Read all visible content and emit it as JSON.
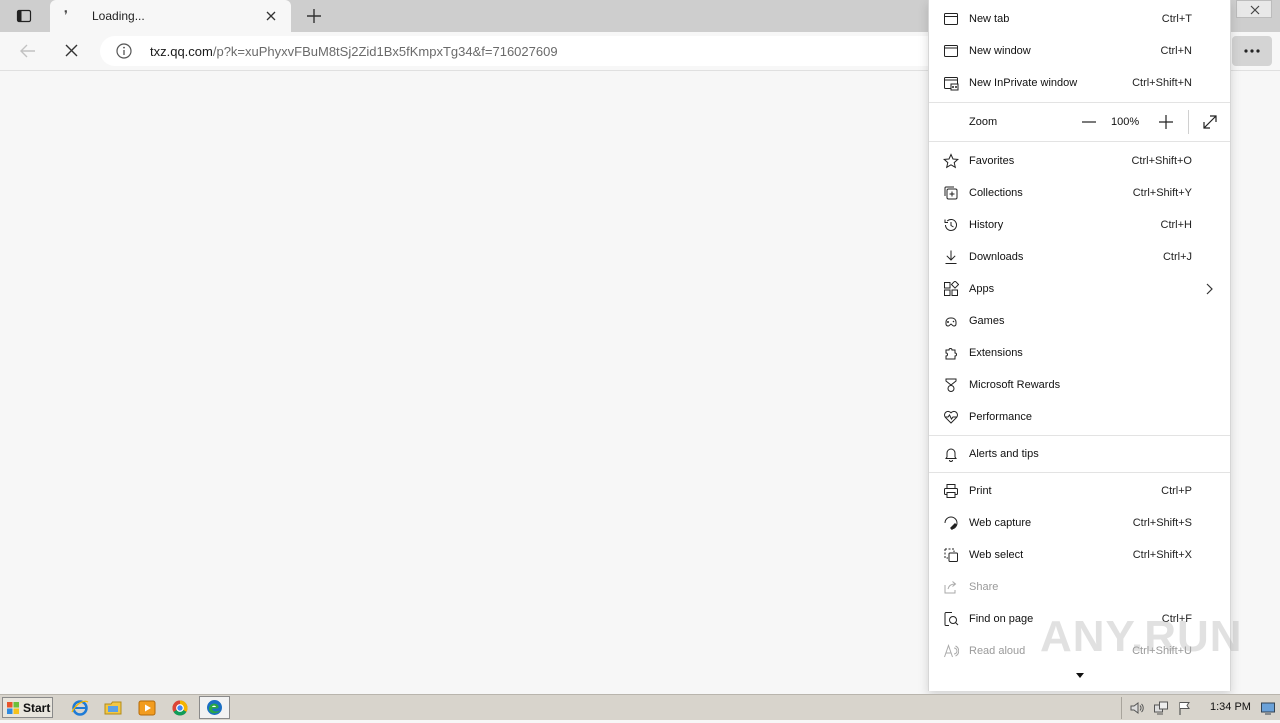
{
  "browser": {
    "tab": {
      "title": "Loading...",
      "spinner": "❜"
    },
    "address": {
      "host": "txz.qq.com",
      "path": "/p?k=xuPhyxvFBuM8tSj2Zid1Bx5fKmpxTg34&f=716027609"
    },
    "window_close_symbol": "✕"
  },
  "menu": {
    "new_tab": {
      "label": "New tab",
      "shortcut": "Ctrl+T"
    },
    "new_window": {
      "label": "New window",
      "shortcut": "Ctrl+N"
    },
    "new_inprivate": {
      "label": "New InPrivate window",
      "shortcut": "Ctrl+Shift+N"
    },
    "zoom": {
      "label": "Zoom",
      "value": "100%"
    },
    "favorites": {
      "label": "Favorites",
      "shortcut": "Ctrl+Shift+O"
    },
    "collections": {
      "label": "Collections",
      "shortcut": "Ctrl+Shift+Y"
    },
    "history": {
      "label": "History",
      "shortcut": "Ctrl+H"
    },
    "downloads": {
      "label": "Downloads",
      "shortcut": "Ctrl+J"
    },
    "apps": {
      "label": "Apps"
    },
    "games": {
      "label": "Games"
    },
    "extensions": {
      "label": "Extensions"
    },
    "rewards": {
      "label": "Microsoft Rewards"
    },
    "performance": {
      "label": "Performance"
    },
    "alerts": {
      "label": "Alerts and tips"
    },
    "print": {
      "label": "Print",
      "shortcut": "Ctrl+P"
    },
    "web_capture": {
      "label": "Web capture",
      "shortcut": "Ctrl+Shift+S"
    },
    "web_select": {
      "label": "Web select",
      "shortcut": "Ctrl+Shift+X"
    },
    "share": {
      "label": "Share"
    },
    "find": {
      "label": "Find on page",
      "shortcut": "Ctrl+F"
    },
    "read_aloud": {
      "label": "Read aloud",
      "shortcut": "Ctrl+Shift+U"
    }
  },
  "watermark": "ANY.RUN",
  "taskbar": {
    "start_label": "Start",
    "clock": "1:34 PM"
  },
  "colors": {
    "edge_blue": "#1b6fc4",
    "accent_green": "#2aa845"
  }
}
